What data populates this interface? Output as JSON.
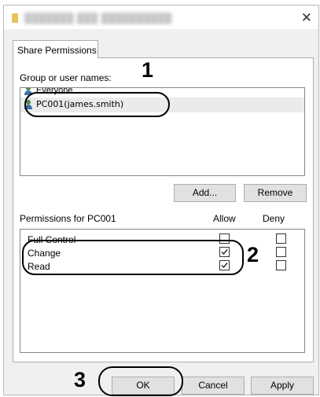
{
  "tabs": [
    {
      "label": "Share Permissions"
    }
  ],
  "group_label": "Group or user names:",
  "users": [
    {
      "label": "Everyone"
    },
    {
      "label": "PC001(james.smith)"
    }
  ],
  "buttons": {
    "add": "Add...",
    "remove": "Remove",
    "ok": "OK",
    "cancel": "Cancel",
    "apply": "Apply"
  },
  "permissions": {
    "header": "Permissions for PC001",
    "allow_label": "Allow",
    "deny_label": "Deny",
    "rows": [
      {
        "name": "Full Control",
        "allow": false,
        "deny": false
      },
      {
        "name": "Change",
        "allow": true,
        "deny": false
      },
      {
        "name": "Read",
        "allow": true,
        "deny": false
      }
    ]
  },
  "callouts": [
    "1",
    "2",
    "3"
  ]
}
